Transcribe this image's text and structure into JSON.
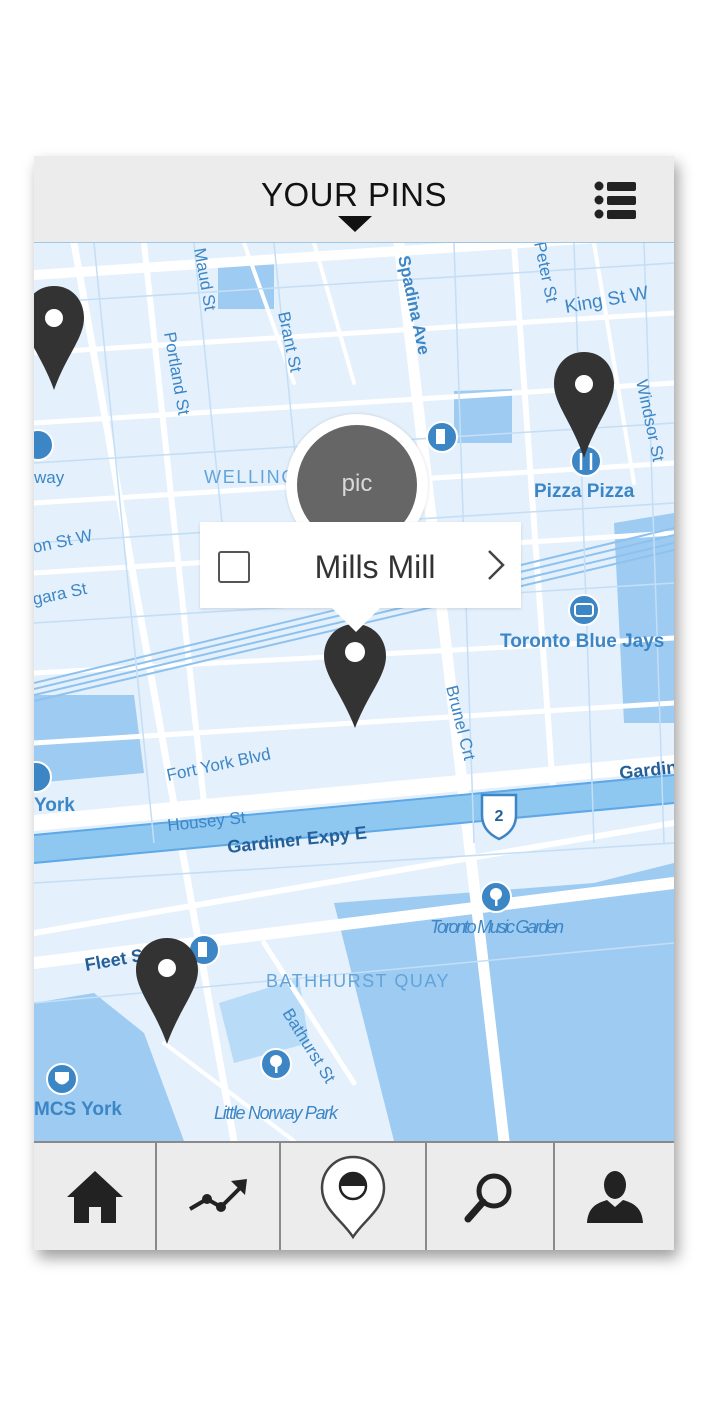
{
  "header": {
    "title": "YOUR PINS",
    "menu_icon": "list-icon"
  },
  "map": {
    "street_labels": [
      "Maud St",
      "Brant St",
      "Spadina Ave",
      "Peter St",
      "King St W",
      "Portland St",
      "Windsor St",
      "Brunel Crt",
      "Fort York Blvd",
      "Housey St",
      "Gardiner Expy E",
      "Gardiner",
      "Bathurst St",
      "Fleet St",
      "on St W",
      "gara St",
      "way"
    ],
    "area_labels": [
      "WELLINGTON PLACE",
      "BATHHURST QUAY"
    ],
    "poi_labels": [
      "Pizza Pizza",
      "Toronto Blue Jays",
      "Toronto Music Garden",
      "Little Norway Park",
      "York",
      "MCS York"
    ],
    "highway_shield": "2",
    "colors": {
      "land": "#e4f0fb",
      "water": "#9ecbf2",
      "road": "#ffffff",
      "label": "#3d86c6"
    }
  },
  "popup": {
    "photo_label": "pic",
    "place_name": "Mills Mill",
    "checked": false
  },
  "pins": [
    "pin-left-edge",
    "pin-pizza-pizza",
    "pin-mills-mill",
    "pin-fleet-st"
  ],
  "tabbar": {
    "tabs": [
      {
        "name": "home",
        "icon": "home-icon"
      },
      {
        "name": "trends",
        "icon": "trend-chart-icon"
      },
      {
        "name": "pins",
        "icon": "map-pin-icon",
        "active": true
      },
      {
        "name": "search",
        "icon": "search-icon"
      },
      {
        "name": "profile",
        "icon": "user-icon"
      }
    ]
  }
}
